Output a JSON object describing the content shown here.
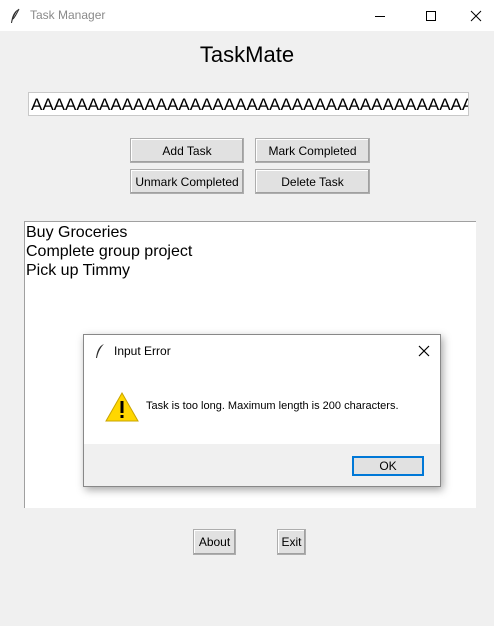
{
  "window": {
    "title": "Task Manager",
    "buttons": [
      "minimize",
      "maximize",
      "close"
    ]
  },
  "app": {
    "heading": "TaskMate",
    "entry_value": "AAAAAAAAAAAAAAAAAAAAAAAAAAAAAAAAAAAAAAAAAA",
    "buttons": {
      "add": "Add Task",
      "mark": "Mark Completed",
      "unmark": "Unmark Completed",
      "delete": "Delete Task",
      "about": "About",
      "exit": "Exit"
    },
    "tasks": [
      "Buy Groceries",
      "Complete group project",
      "Pick up Timmy"
    ]
  },
  "dialog": {
    "title": "Input Error",
    "message": "Task is too long. Maximum length is 200 characters.",
    "ok_label": "OK",
    "icon": "warning-icon"
  },
  "colors": {
    "accent": "#0078d7",
    "warning": "#ffd700"
  }
}
